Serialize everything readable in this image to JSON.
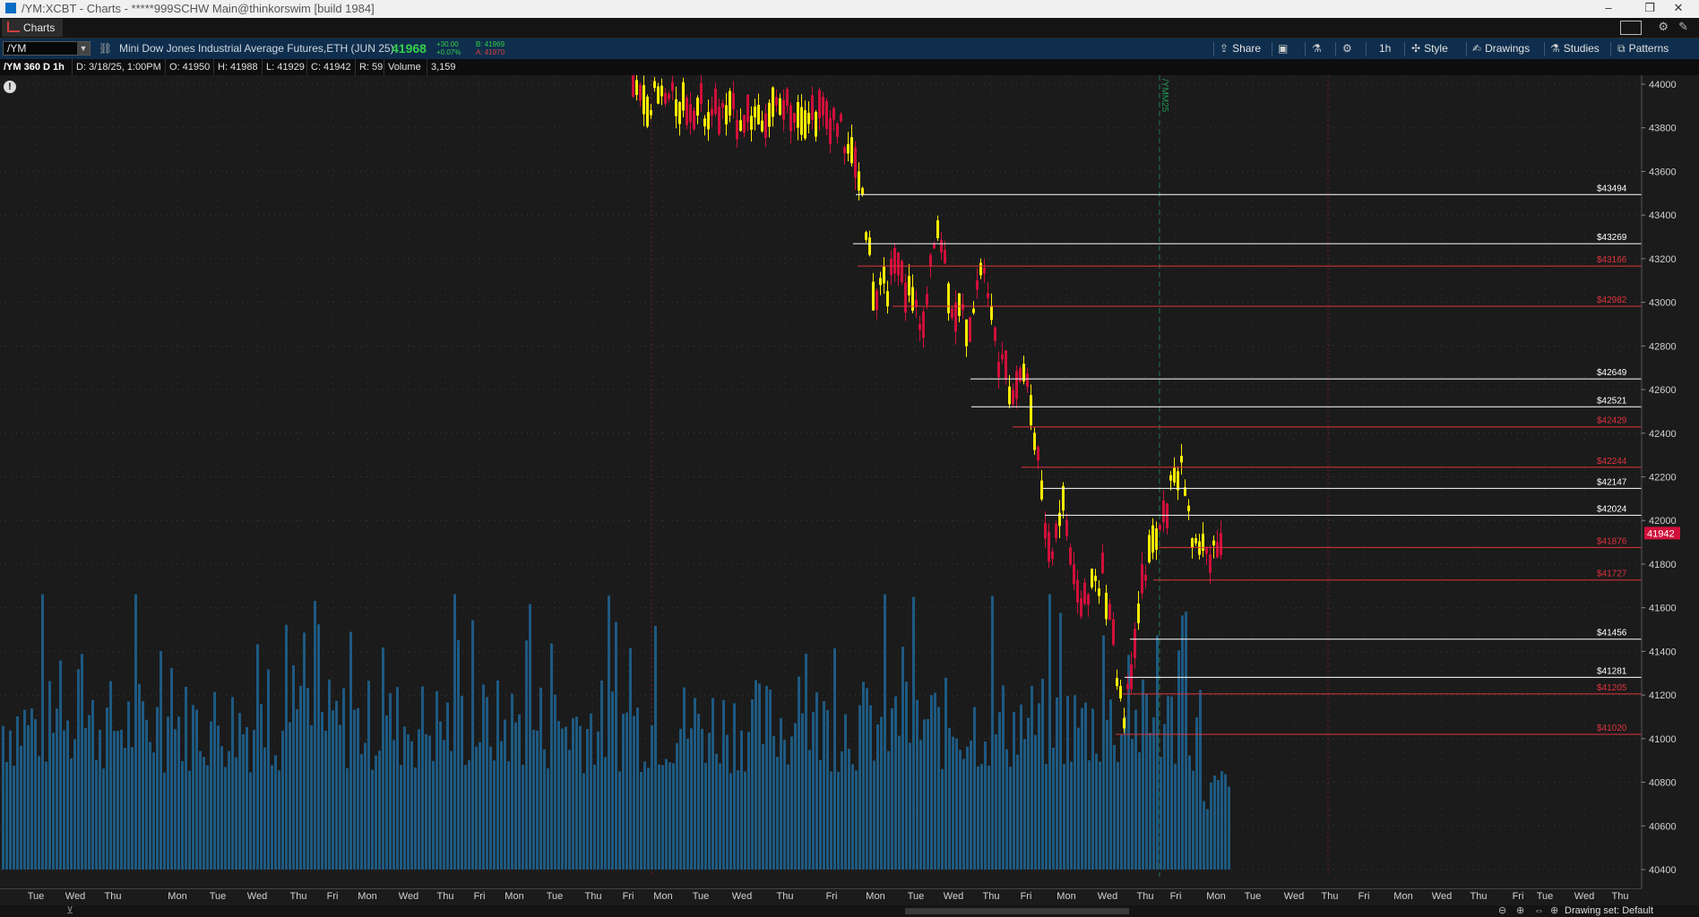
{
  "window": {
    "title": "/YM:XCBT - Charts - *****999SCHW Main@thinkorswim [build 1984]",
    "minimize": "–",
    "maximize": "❐",
    "close": "✕"
  },
  "tabs": [
    {
      "label": "Charts"
    }
  ],
  "toolbar": {
    "symbol": "/YM",
    "description": "Mini Dow Jones Industrial Average Futures,ETH (JUN 25)",
    "last_price": "41968",
    "net_change": "+30.00",
    "pct_change": "+0.07%",
    "bid": "B: 41969",
    "ask": "A: 41970",
    "share_label": "Share",
    "timeframe_label": "1h",
    "style_label": "Style",
    "drawings_label": "Drawings",
    "studies_label": "Studies",
    "patterns_label": "Patterns"
  },
  "infobar": {
    "symbol": "/YM 360 D 1h",
    "date": "D: 3/18/25, 1:00PM",
    "open": "O: 41950",
    "high": "H: 41988",
    "low": "L: 41929",
    "close": "C: 41942",
    "range": "R: 59",
    "volume_label": "Volume",
    "volume_value": "3,159"
  },
  "chart_data": {
    "type": "candlestick",
    "instrument": "/YM",
    "ylim": [
      40350,
      44050
    ],
    "y_ticks": [
      44000,
      43800,
      43600,
      43400,
      43200,
      43000,
      42800,
      42600,
      42400,
      42200,
      42000,
      41800,
      41600,
      41400,
      41200,
      41000,
      40800,
      40600,
      40400
    ],
    "current_price": "41942",
    "x_labels": [
      "Tue",
      "Wed",
      "Thu",
      "Mon",
      "Tue",
      "Wed",
      "Thu",
      "Fri",
      "Mon",
      "Wed",
      "Thu",
      "Fri",
      "Mon",
      "Tue",
      "Thu",
      "Fri",
      "Mon",
      "Tue",
      "Wed",
      "Thu",
      "Fri",
      "Mon",
      "Tue",
      "Wed",
      "Thu",
      "Fri",
      "Mon",
      "Wed",
      "Thu",
      "Fri",
      "Mon",
      "Tue",
      "Wed",
      "Thu",
      "Fri",
      "Mon",
      "Wed",
      "Thu",
      "Fri",
      "Tue",
      "Wed",
      "Thu"
    ],
    "expiry_label": "/YMM25",
    "levels": [
      {
        "value": 43494,
        "label": "$43494",
        "color": "#ffffff"
      },
      {
        "value": 43269,
        "label": "$43269",
        "color": "#ffffff"
      },
      {
        "value": 43166,
        "label": "$43166",
        "color": "#e0333c"
      },
      {
        "value": 42982,
        "label": "$42982",
        "color": "#e0333c"
      },
      {
        "value": 42649,
        "label": "$42649",
        "color": "#ffffff"
      },
      {
        "value": 42521,
        "label": "$42521",
        "color": "#ffffff"
      },
      {
        "value": 42429,
        "label": "$42429",
        "color": "#e0333c"
      },
      {
        "value": 42244,
        "label": "$42244",
        "color": "#e0333c"
      },
      {
        "value": 42147,
        "label": "$42147",
        "color": "#ffffff"
      },
      {
        "value": 42024,
        "label": "$42024",
        "color": "#ffffff"
      },
      {
        "value": 41876,
        "label": "$41876",
        "color": "#e0333c"
      },
      {
        "value": 41727,
        "label": "$41727",
        "color": "#e0333c"
      },
      {
        "value": 41456,
        "label": "$41456",
        "color": "#ffffff"
      },
      {
        "value": 41281,
        "label": "$41281",
        "color": "#ffffff"
      },
      {
        "value": 41205,
        "label": "$41205",
        "color": "#e0333c"
      },
      {
        "value": 41020,
        "label": "$41020",
        "color": "#e0333c"
      }
    ],
    "colors": {
      "up": "#ffec00",
      "down": "#d0103a",
      "volume": "#1e5a82",
      "background": "#1b1b1b",
      "grid": "#3a3a3a"
    }
  },
  "statusbar": {
    "drawing_set": "Drawing set: Default"
  }
}
